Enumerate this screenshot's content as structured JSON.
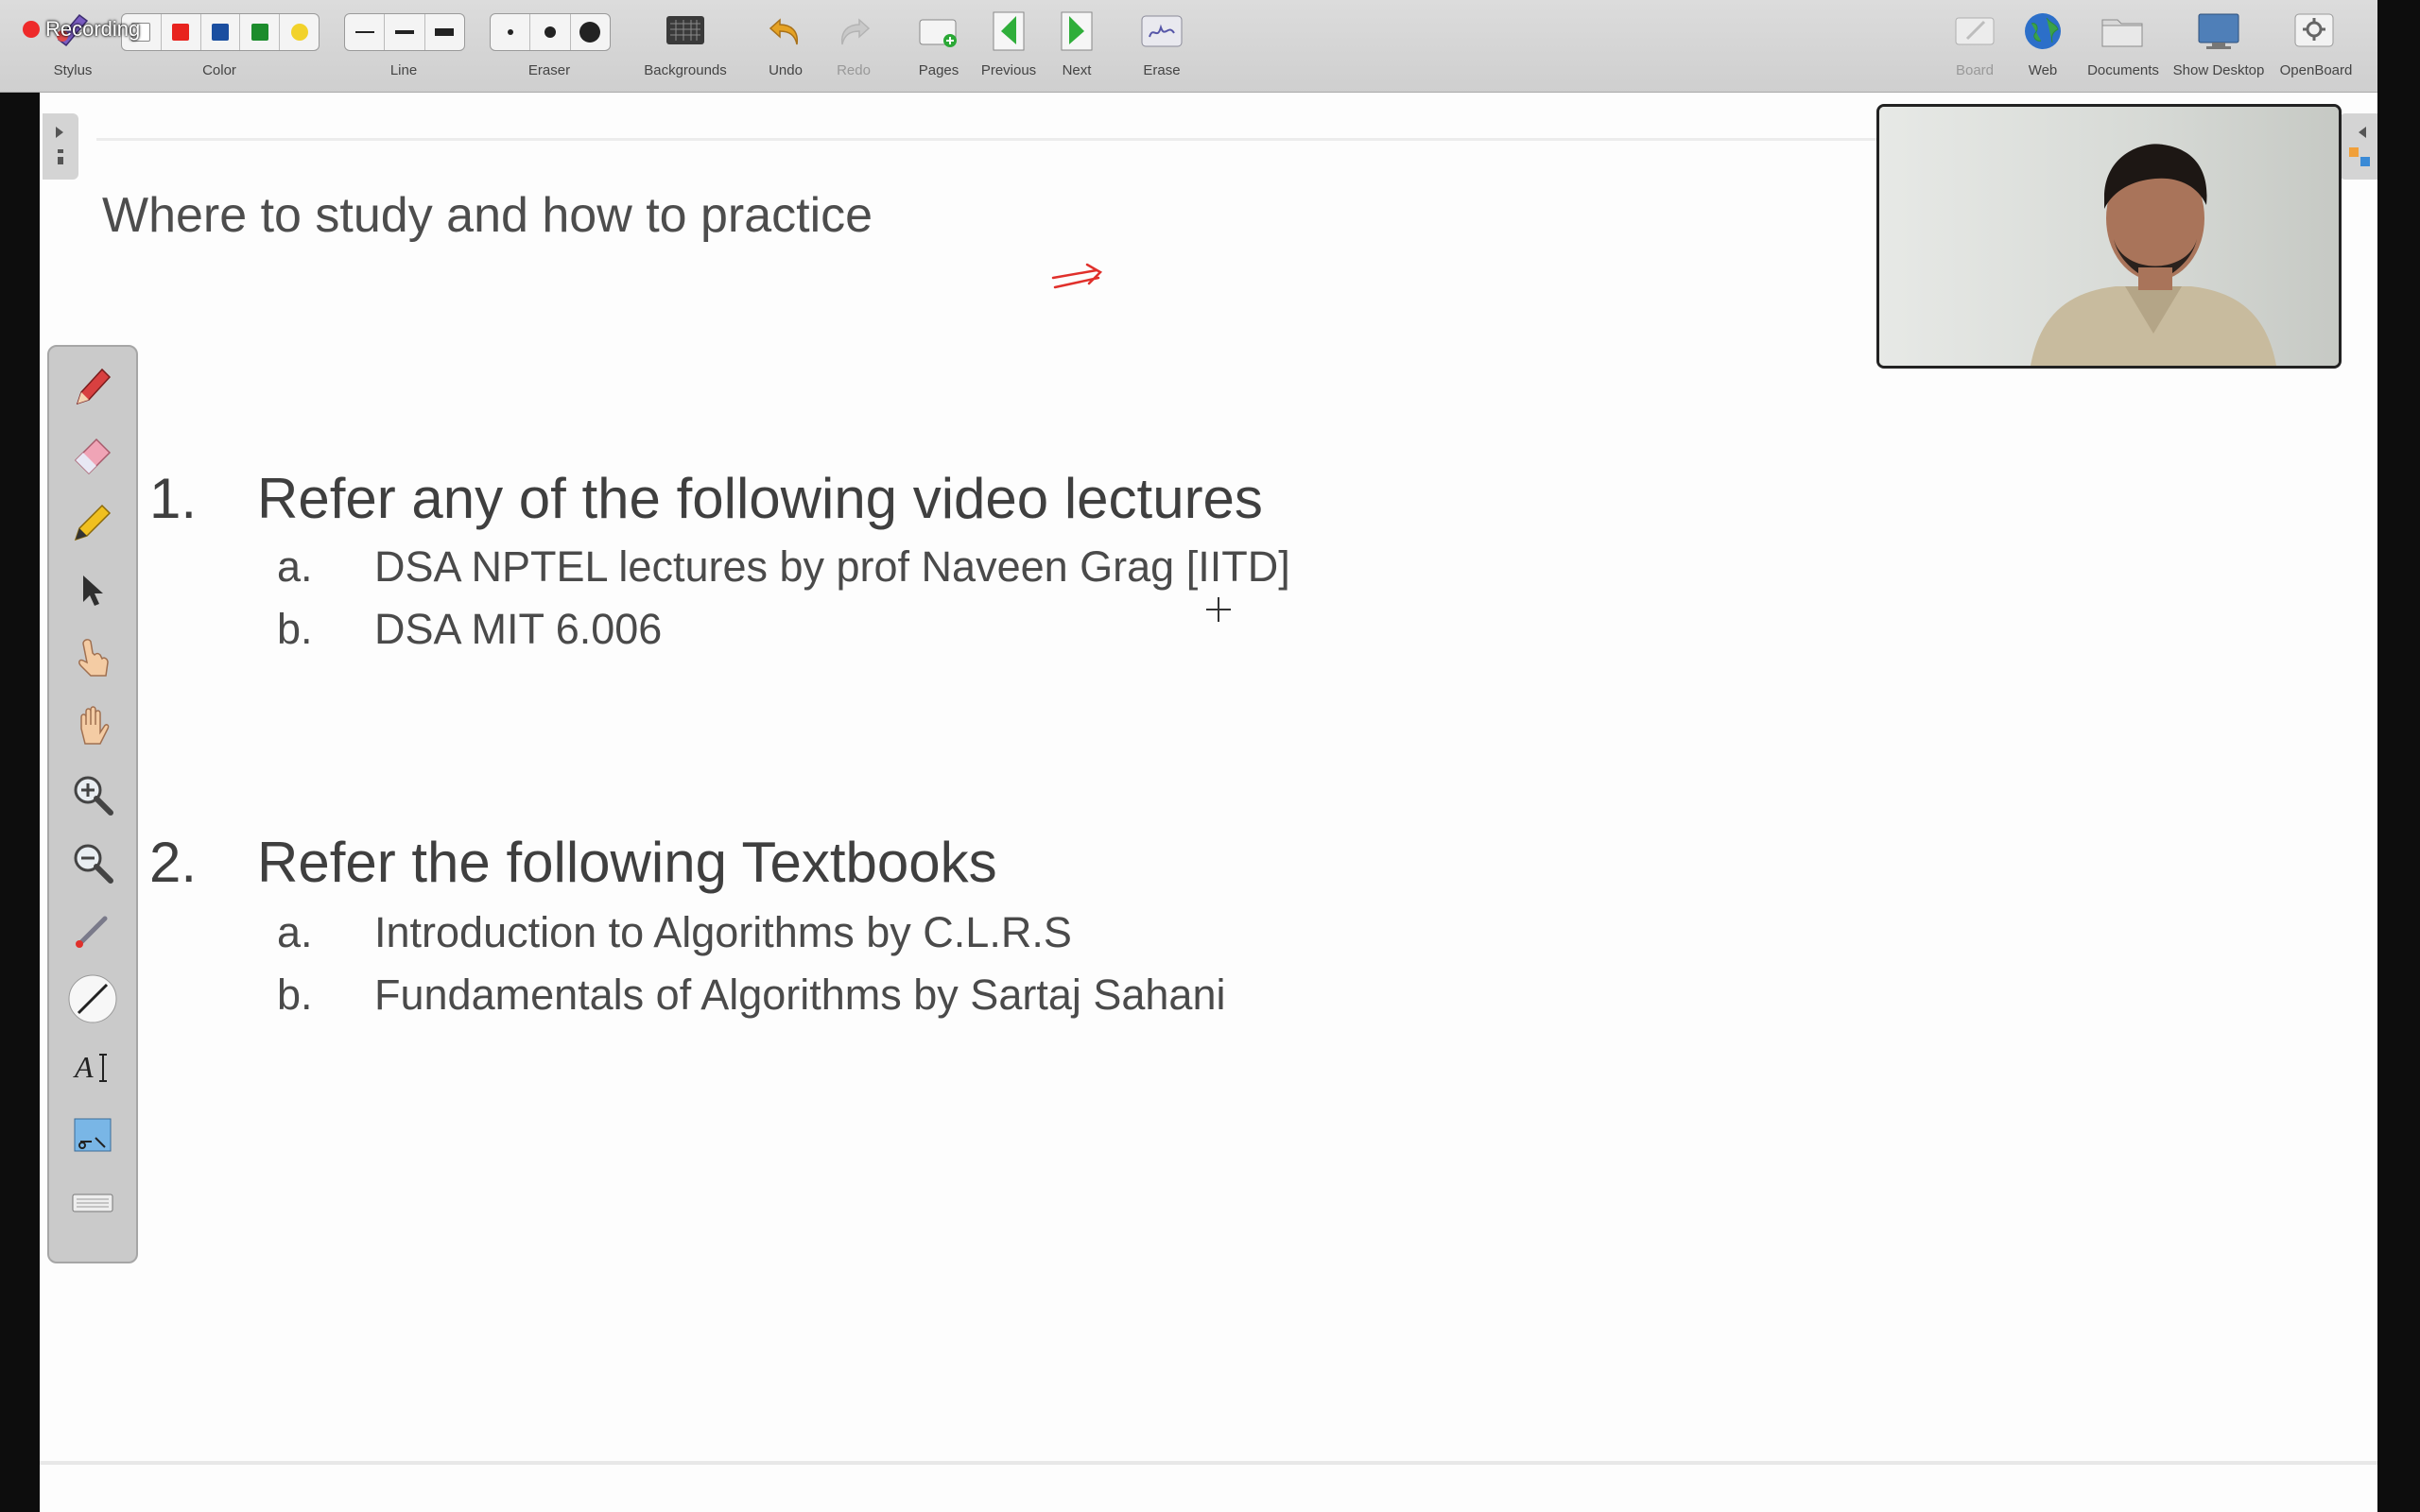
{
  "recording": {
    "label": "Recording"
  },
  "toolbar": {
    "stylus_label": "Stylus",
    "color_label": "Color",
    "line_label": "Line",
    "eraser_label": "Eraser",
    "backgrounds_label": "Backgrounds",
    "undo_label": "Undo",
    "redo_label": "Redo",
    "pages_label": "Pages",
    "previous_label": "Previous",
    "next_label": "Next",
    "erase_label": "Erase",
    "board_label": "Board",
    "web_label": "Web",
    "documents_label": "Documents",
    "show_desktop_label": "Show Desktop",
    "openboard_label": "OpenBoard",
    "colors": [
      "#ffffff",
      "#e8231e",
      "#1b4fa0",
      "#1c8c2c",
      "#f2d22a"
    ]
  },
  "slide": {
    "title": "Where to study and how to practice",
    "sections": [
      {
        "number": "1.",
        "heading": "Refer any of the following video lectures",
        "items": [
          {
            "letter": "a.",
            "text": "DSA NPTEL lectures by prof Naveen Grag [IITD]"
          },
          {
            "letter": "b.",
            "text": "DSA MIT 6.006"
          }
        ]
      },
      {
        "number": "2.",
        "heading": "Refer the following Textbooks",
        "items": [
          {
            "letter": "a.",
            "text": "Introduction to Algorithms by C.L.R.S"
          },
          {
            "letter": "b.",
            "text": "Fundamentals of Algorithms by Sartaj Sahani"
          }
        ]
      }
    ]
  },
  "palette": {
    "tools": [
      "pen-icon",
      "eraser-tool-icon",
      "highlighter-icon",
      "selector-icon",
      "interact-icon",
      "hand-icon",
      "zoom-in-icon",
      "zoom-out-icon",
      "laser-pointer-icon",
      "line-tool-icon",
      "text-tool-icon",
      "capture-icon",
      "keyboard-icon"
    ]
  },
  "accent_color": "#e0302b"
}
